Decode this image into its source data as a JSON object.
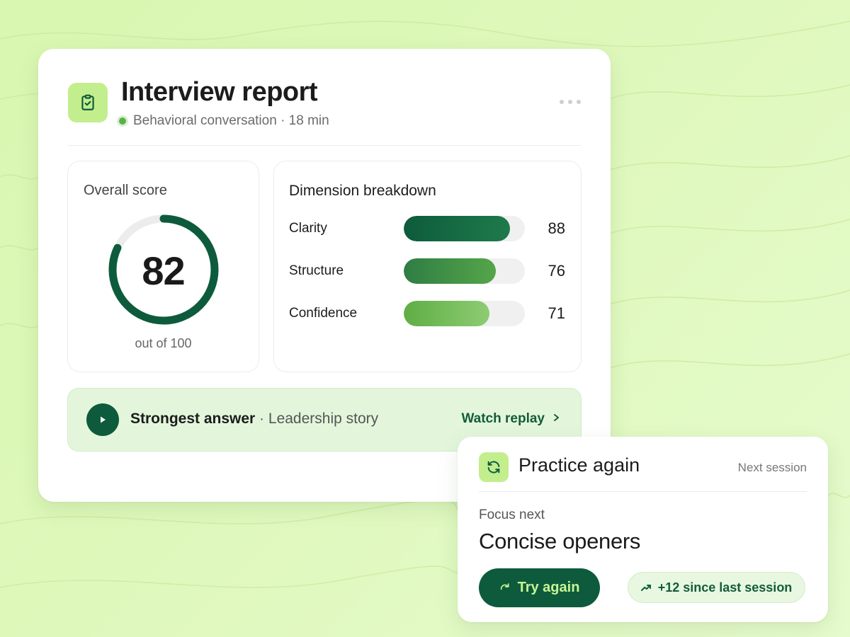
{
  "report": {
    "title": "Interview report",
    "subtitle": "Behavioral conversation · 18 min",
    "header_icon": "clipboard-check-icon",
    "more_icon": "more-horizontal-icon"
  },
  "overall": {
    "title": "Overall score",
    "score": 82,
    "score_text": "82",
    "max": 100,
    "caption": "out of 100"
  },
  "breakdown": {
    "title": "Dimension breakdown",
    "items": [
      {
        "label": "Clarity",
        "value": 88,
        "value_text": "88",
        "fill_from": "#0d5b3c",
        "fill_to": "#1f7a4b"
      },
      {
        "label": "Structure",
        "value": 76,
        "value_text": "76",
        "fill_from": "#2f7d44",
        "fill_to": "#55a54a"
      },
      {
        "label": "Confidence",
        "value": 71,
        "value_text": "71",
        "fill_from": "#5fae45",
        "fill_to": "#8dcc72"
      }
    ]
  },
  "strongest": {
    "label": "Strongest answer",
    "separator": " · ",
    "detail": "Leadership story",
    "link": "Watch replay",
    "play_icon": "play-icon",
    "chevron_icon": "chevron-right-icon"
  },
  "practice": {
    "title": "Practice again",
    "meta": "Next session",
    "focus_label": "Focus next",
    "focus_value": "Concise openers",
    "try_label": "Try again",
    "delta": "+12 since last session",
    "icon": "refresh-icon",
    "try_icon": "redo-icon",
    "delta_icon": "trending-up-icon"
  },
  "colors": {
    "brand_dark": "#0d5b3c",
    "accent_lime": "#c3ee8e",
    "background": "#dcf7b6",
    "ring_track": "#ececec"
  }
}
